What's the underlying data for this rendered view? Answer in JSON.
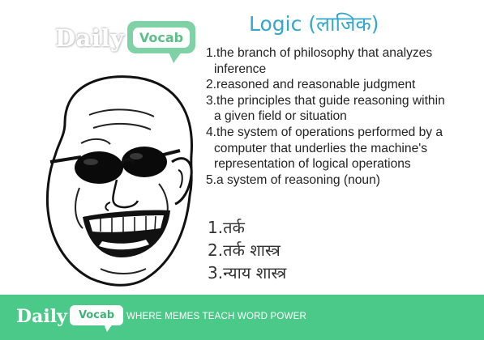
{
  "brand": {
    "daily": "Daily",
    "vocab": "Vocab"
  },
  "word": {
    "title": "Logic (लाजिक)"
  },
  "definitions": [
    "1.the branch of philosophy that analyzes",
    "inference",
    "2.reasoned and reasonable judgment",
    "3.the principles that guide reasoning within",
    "a given field or situation",
    "4.the system of operations performed by a",
    "computer that underlies the machine's",
    "representation of logical operations",
    "5.a system of reasoning (noun)"
  ],
  "hindi_meanings": [
    "1.तर्क",
    "2.तर्क शास्त्र",
    "3.न्याय शास्त्र"
  ],
  "footer": {
    "daily": "Daily",
    "vocab": "Vocab",
    "tagline": "WHERE MEMES TEACH WORD POWER"
  },
  "colors": {
    "accent": "#4bc989",
    "title": "#35a6cc"
  },
  "illustration": "bald-man-sunglasses-grin-meme"
}
